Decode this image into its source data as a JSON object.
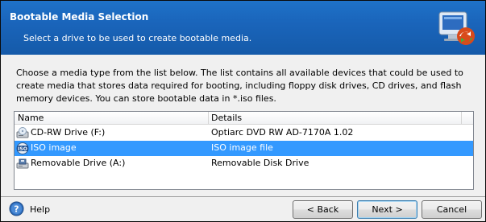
{
  "header": {
    "title": "Bootable Media Selection",
    "subtitle": "Select a drive to be used to create bootable media."
  },
  "description": "Choose a media type from the list below. The list contains all available devices that could be used to create media that stores data required for booting, including floppy disk drives, CD drives, and flash memory devices. You can store bootable data in *.iso files.",
  "list": {
    "columns": {
      "name": "Name",
      "details": "Details"
    },
    "rows": [
      {
        "name": "CD-RW Drive (F:)",
        "details": "Optiarc DVD RW AD-7170A 1.02",
        "icon": "cd-drive-icon",
        "selected": false
      },
      {
        "name": "ISO image",
        "details": "ISO image file",
        "icon": "iso-image-icon",
        "selected": true
      },
      {
        "name": "Removable Drive (A:)",
        "details": "Removable Disk Drive",
        "icon": "removable-drive-icon",
        "selected": false
      }
    ]
  },
  "footer": {
    "help_label": "Help",
    "back_label": "< Back",
    "next_label": "Next >",
    "cancel_label": "Cancel"
  },
  "colors": {
    "header_bg": "#1a65bb",
    "selection": "#3399ff"
  }
}
